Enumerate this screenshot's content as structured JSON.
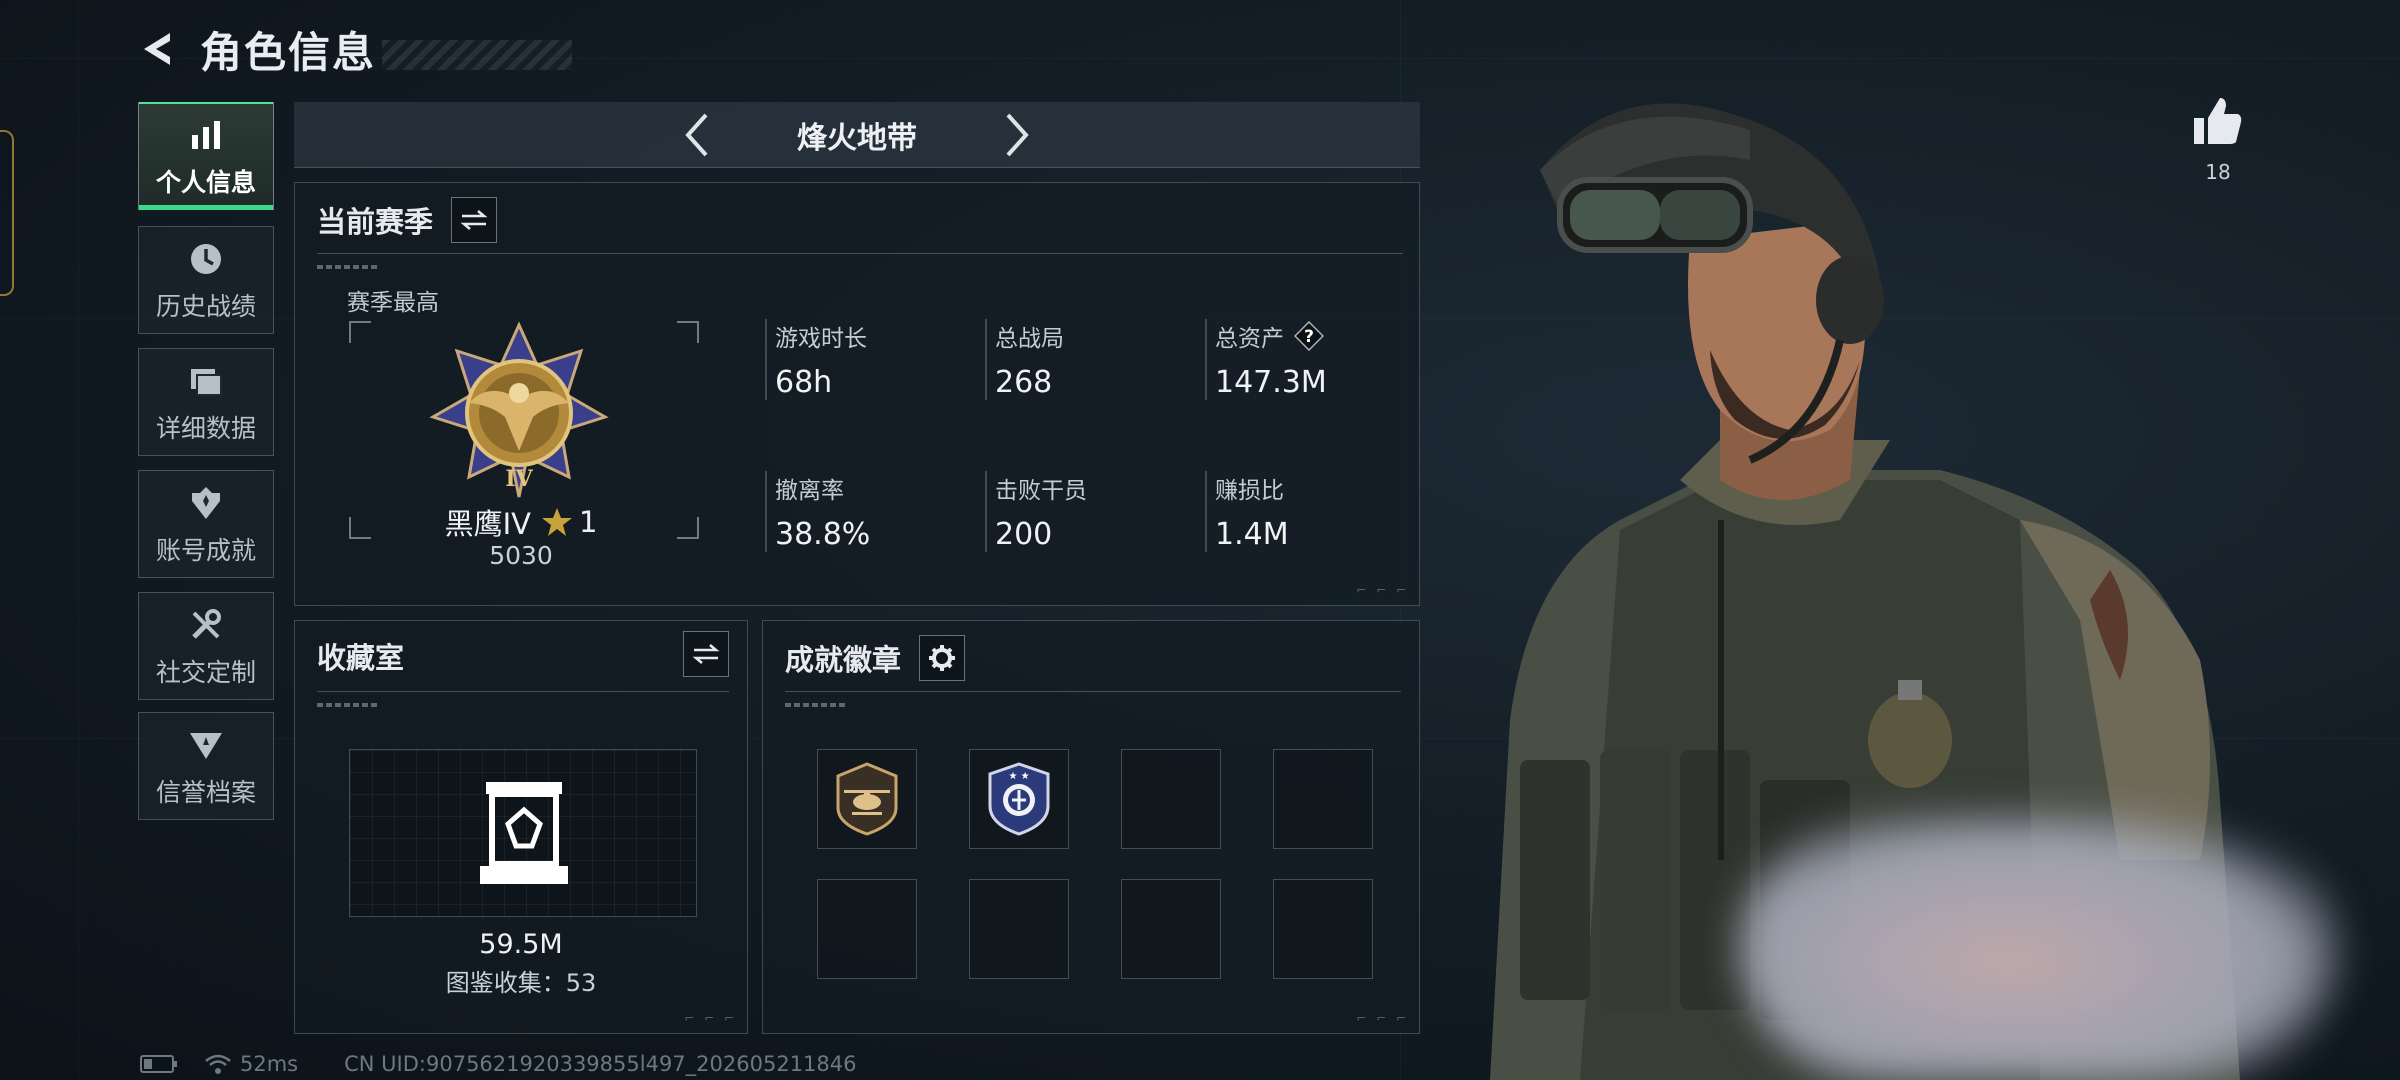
{
  "header": {
    "title": "角色信息"
  },
  "sidebar": {
    "items": [
      {
        "label": "个人信息",
        "icon": "bar-chart-icon",
        "active": true
      },
      {
        "label": "历史战绩",
        "icon": "history-clock-icon",
        "active": false
      },
      {
        "label": "详细数据",
        "icon": "documents-icon",
        "active": false
      },
      {
        "label": "账号成就",
        "icon": "achievement-icon",
        "active": false
      },
      {
        "label": "社交定制",
        "icon": "tools-icon",
        "active": false
      },
      {
        "label": "信誉档案",
        "icon": "reputation-icon",
        "active": false
      }
    ]
  },
  "mode": {
    "name": "烽火地带"
  },
  "season": {
    "title": "当前赛季",
    "best_label": "赛季最高",
    "rank_name": "黑鹰IV",
    "rank_stars": "1",
    "rank_score": "5030",
    "stats": [
      {
        "key": "游戏时长",
        "value": "68h"
      },
      {
        "key": "总战局",
        "value": "268"
      },
      {
        "key": "总资产",
        "value": "147.3M",
        "help_icon": "question-icon"
      },
      {
        "key": "撤离率",
        "value": "38.8%"
      },
      {
        "key": "击败干员",
        "value": "200"
      },
      {
        "key": "赚损比",
        "value": "1.4M"
      }
    ]
  },
  "collection": {
    "title": "收藏室",
    "value": "59.5M",
    "count_text": "图鉴收集：53"
  },
  "badges": {
    "title": "成就徽章",
    "slots": [
      {
        "icon": "helicopter-badge-icon",
        "filled": true
      },
      {
        "icon": "police-shield-badge-icon",
        "filled": true
      },
      {
        "filled": false
      },
      {
        "filled": false
      },
      {
        "filled": false
      },
      {
        "filled": false
      },
      {
        "filled": false
      },
      {
        "filled": false
      }
    ]
  },
  "like": {
    "count": "18"
  },
  "footer": {
    "ping": "52ms",
    "uid": "CN UID:9075621920339855l497_202605211846"
  },
  "colors": {
    "accent_green": "#3ed88a",
    "gold": "#c9a23a"
  }
}
